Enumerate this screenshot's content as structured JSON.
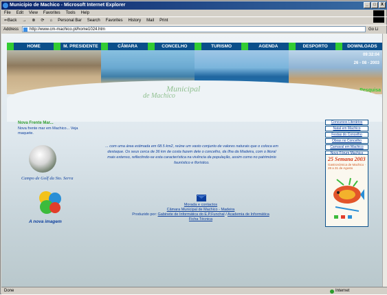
{
  "window": {
    "title": "Município de Machico - Microsoft Internet Explorer",
    "controls": {
      "minimize": "_",
      "maximize": "□",
      "close": "X"
    }
  },
  "menubar": [
    "File",
    "Edit",
    "View",
    "Favorites",
    "Tools",
    "Help"
  ],
  "toolbar": [
    "⇐Back",
    "→",
    "⊗",
    "⟳",
    "⌂",
    "Personal Bar",
    "Search",
    "Favorites",
    "History",
    "Mail",
    "Print"
  ],
  "address": {
    "label": "Address",
    "url": "http://www.cm-machico.pt/home1024.htm",
    "go": "Go",
    "links": "Li"
  },
  "nav": [
    "HOME",
    "M. PRESIDENTE",
    "CÂMARA",
    "CONCELHO",
    "TURISMO",
    "AGENDA",
    "DESPORTO",
    "DOWNLOADS"
  ],
  "banner": {
    "time": "09:32:04",
    "date": "26 - 08 - 2003",
    "search": "Pesquisa"
  },
  "heading": {
    "line1": "Municipal",
    "line2": "de Machico"
  },
  "news": {
    "title": "Nova Frente Mar...",
    "text": "Nova frente mar em Machico... Veja maquete."
  },
  "golf": {
    "caption": "Campo de Golf da Sto. Serra"
  },
  "logo": {
    "caption": "A nova imagem"
  },
  "intro": "... com uma área estimada em 68.5 km2, reúne um vasto conjunto de valores naturais que o coloca em destaque. Os seus cerca de 36 km de costa fazem dele o concelho, da Ilha da Madeira, com o litoral mais extenso, reflectindo-se esta característica na vivência da população, assim como no património faunístico e florístico.",
  "footer": {
    "contact": "Morada e contactos",
    "org": "Câmara Municipal de Machico - Madeira",
    "produced_by": "Produzido por:",
    "producer1": "Gabinete de Informática do E.P.Funchal",
    "separator": "/",
    "producer2": "Academia de Informática",
    "tech": "Ficha Técnica"
  },
  "right_links": [
    "Concursos Literários",
    "Natal em Machico",
    "Festas do Concelho",
    "Obras no Concelho",
    "Carnaval em Machico",
    "Novo Fórum Machico"
  ],
  "poster": {
    "head": "25 Semana 2003",
    "sub": "Gastronómica de Machico · 28 a 31 de Agosto"
  },
  "statusbar": {
    "left": "Done",
    "zone": "Internet"
  }
}
